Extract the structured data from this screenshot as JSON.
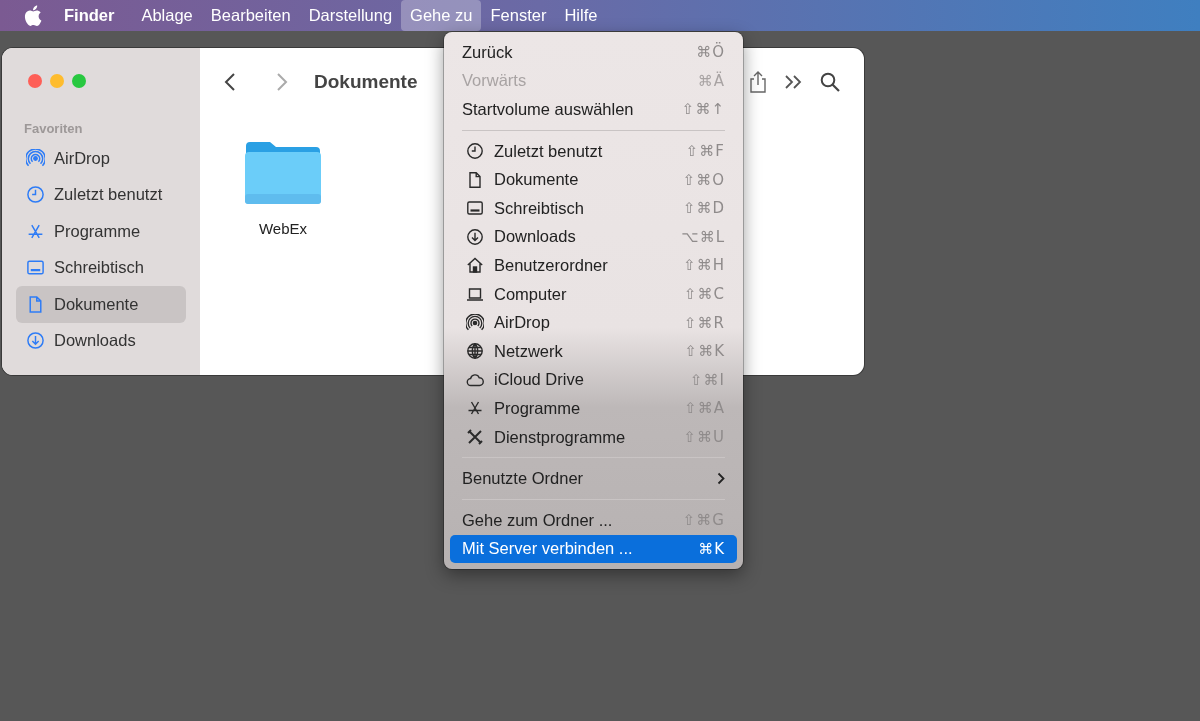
{
  "menu_bar": {
    "items": [
      {
        "label": "Finder",
        "kind": "app",
        "selected": false
      },
      {
        "label": "Ablage",
        "kind": "menu",
        "selected": false
      },
      {
        "label": "Bearbeiten",
        "kind": "menu",
        "selected": false
      },
      {
        "label": "Darstellung",
        "kind": "menu",
        "selected": false
      },
      {
        "label": "Gehe zu",
        "kind": "menu",
        "selected": true
      },
      {
        "label": "Fenster",
        "kind": "menu",
        "selected": false
      },
      {
        "label": "Hilfe",
        "kind": "menu",
        "selected": false
      }
    ]
  },
  "finder_window": {
    "title": "Dokumente",
    "sidebar": {
      "heading": "Favoriten",
      "items": [
        {
          "label": "AirDrop",
          "kind": "airdrop",
          "selected": false
        },
        {
          "label": "Zuletzt benutzt",
          "kind": "clock",
          "selected": false
        },
        {
          "label": "Programme",
          "kind": "apps",
          "selected": false
        },
        {
          "label": "Schreibtisch",
          "kind": "desktop",
          "selected": false
        },
        {
          "label": "Dokumente",
          "kind": "doc",
          "selected": true
        },
        {
          "label": "Downloads",
          "kind": "download",
          "selected": false
        }
      ]
    },
    "files": [
      {
        "name": "WebEx",
        "kind": "folder"
      }
    ]
  },
  "go_menu": {
    "sections": [
      [
        {
          "label": "Zurück",
          "shortcut": "⌘Ö",
          "kind": "plain",
          "disabled": false,
          "selected": false
        },
        {
          "label": "Vorwärts",
          "shortcut": "⌘Ä",
          "kind": "plain",
          "disabled": true,
          "selected": false
        },
        {
          "label": "Startvolume auswählen",
          "shortcut": "⇧⌘↑",
          "kind": "plain",
          "disabled": false,
          "selected": false
        }
      ],
      [
        {
          "label": "Zuletzt benutzt",
          "shortcut": "⇧⌘F",
          "kind": "clock",
          "disabled": false,
          "selected": false
        },
        {
          "label": "Dokumente",
          "shortcut": "⇧⌘O",
          "kind": "doc",
          "disabled": false,
          "selected": false
        },
        {
          "label": "Schreibtisch",
          "shortcut": "⇧⌘D",
          "kind": "desktop",
          "disabled": false,
          "selected": false
        },
        {
          "label": "Downloads",
          "shortcut": "⌥⌘L",
          "kind": "download",
          "disabled": false,
          "selected": false
        },
        {
          "label": "Benutzerordner",
          "shortcut": "⇧⌘H",
          "kind": "home",
          "disabled": false,
          "selected": false
        },
        {
          "label": "Computer",
          "shortcut": "⇧⌘C",
          "kind": "laptop",
          "disabled": false,
          "selected": false
        },
        {
          "label": "AirDrop",
          "shortcut": "⇧⌘R",
          "kind": "airdrop",
          "disabled": false,
          "selected": false
        },
        {
          "label": "Netzwerk",
          "shortcut": "⇧⌘K",
          "kind": "globe",
          "disabled": false,
          "selected": false
        },
        {
          "label": "iCloud Drive",
          "shortcut": "⇧⌘I",
          "kind": "cloud",
          "disabled": false,
          "selected": false
        },
        {
          "label": "Programme",
          "shortcut": "⇧⌘A",
          "kind": "apps",
          "disabled": false,
          "selected": false
        },
        {
          "label": "Dienstprogramme",
          "shortcut": "⇧⌘U",
          "kind": "tools",
          "disabled": false,
          "selected": false
        }
      ],
      [
        {
          "label": "Benutzte Ordner",
          "kind": "submenu",
          "disabled": false,
          "selected": false
        }
      ],
      [
        {
          "label": "Gehe zum Ordner ...",
          "shortcut": "⇧⌘G",
          "kind": "plain",
          "disabled": false,
          "selected": false
        },
        {
          "label": "Mit Server verbinden ...",
          "shortcut": "⌘K",
          "kind": "plain",
          "disabled": false,
          "selected": true
        }
      ]
    ]
  }
}
